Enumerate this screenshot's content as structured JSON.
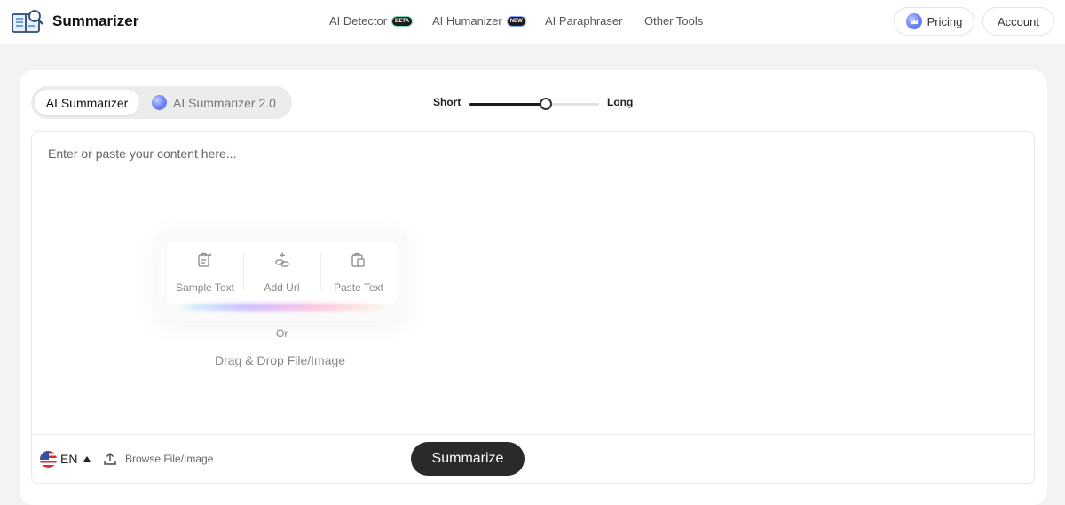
{
  "header": {
    "brand": "Summarizer",
    "nav": [
      {
        "label": "AI Detector",
        "badge": "BETA"
      },
      {
        "label": "AI Humanizer",
        "badge": "NEW"
      },
      {
        "label": "AI Paraphraser"
      },
      {
        "label": "Other Tools"
      }
    ],
    "pricing_label": "Pricing",
    "account_label": "Account"
  },
  "modes": {
    "active": "AI Summarizer",
    "other": "AI Summarizer 2.0"
  },
  "length_slider": {
    "min_label": "Short",
    "max_label": "Long",
    "value_fraction": 0.59
  },
  "editor": {
    "placeholder": "Enter or paste your content here...",
    "actions": [
      {
        "label": "Sample Text",
        "icon": "clipboard-sparkle-icon"
      },
      {
        "label": "Add Url",
        "icon": "link-add-icon"
      },
      {
        "label": "Paste Text",
        "icon": "paste-icon"
      }
    ],
    "or_text": "Or",
    "drag_text": "Drag & Drop File/Image"
  },
  "footer": {
    "language": "EN",
    "browse_label": "Browse File/Image",
    "summarize_label": "Summarize"
  },
  "colors": {
    "accent_dark": "#2a2a2a",
    "background": "#f3f3f3",
    "card": "#ffffff"
  }
}
